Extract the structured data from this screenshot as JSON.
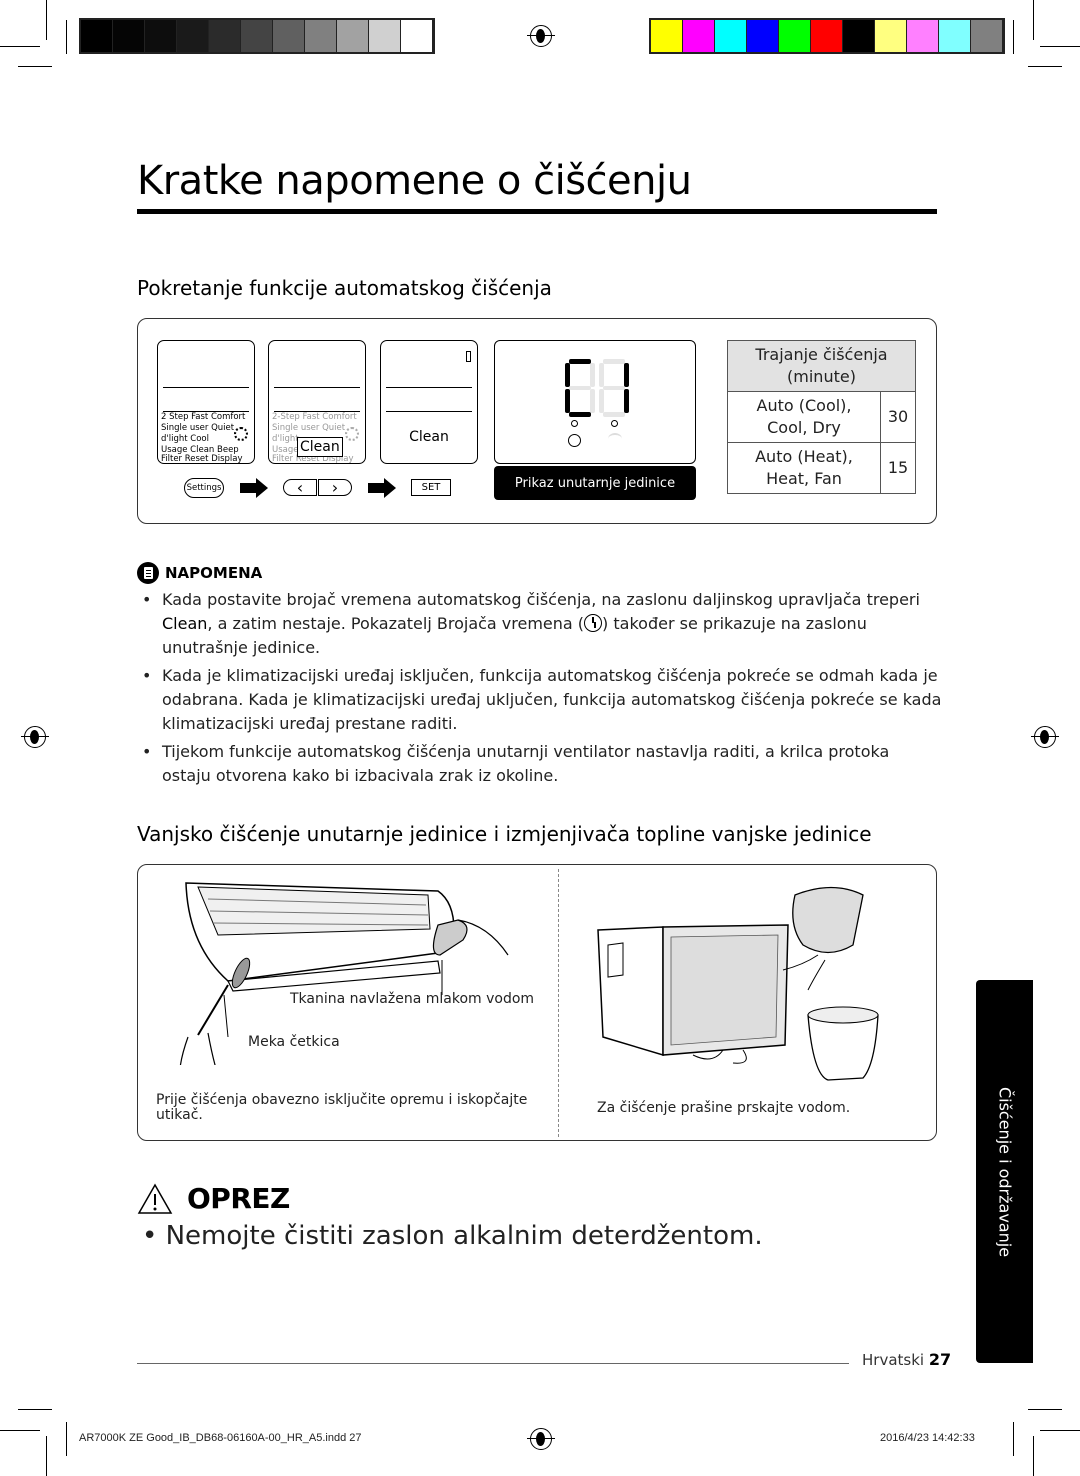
{
  "print_marks": {
    "gray_swatches": [
      "#000000",
      "#050505",
      "#0d0d0d",
      "#1a1a1a",
      "#2b2b2b",
      "#444444",
      "#606060",
      "#808080",
      "#a2a2a2",
      "#d0d0d0",
      "#ffffff"
    ],
    "color_swatches": [
      "#ffff00",
      "#ff00ff",
      "#00ffff",
      "#0000ff",
      "#00ff00",
      "#ff0000",
      "#000000",
      "#ffff80",
      "#ff80ff",
      "#80ffff",
      "#808080"
    ]
  },
  "page": {
    "title": "Kratke napomene o čišćenju",
    "section1_heading": "Pokretanje funkcije automatskog čišćenja",
    "section2_heading": "Vanjsko čišćenje unutarnje jedinice i izmjenjivača topline vanjske jedinice"
  },
  "remote_steps": {
    "menu_lines": [
      "2 Step  Fast  Comfort",
      "Single user  Quiet",
      "d'light Cool",
      "Usage   Clean   Beep",
      "Filter Reset    Display"
    ],
    "menu_lines_faded": [
      "2-Step  Fast  Comfort",
      "Single user  Quiet",
      "d'light",
      "Usage          Beep",
      "Filter Reset    Display"
    ],
    "highlight_label": "Clean",
    "result_label": "Clean",
    "settings_button": "Settings",
    "left_button": "‹",
    "right_button": "›",
    "set_button": "SET"
  },
  "indoor_display": {
    "digits": "C",
    "label": "Prikaz unutarnje jedinice",
    "timer_icon": "timer-icon",
    "wifi_icon": "wifi-icon"
  },
  "duration_table": {
    "header": [
      "Trajanje čišćenja",
      "(minute)"
    ],
    "rows": [
      {
        "modes": [
          "Auto (Cool),",
          "Cool, Dry"
        ],
        "minutes": "30"
      },
      {
        "modes": [
          "Auto (Heat),",
          "Heat, Fan"
        ],
        "minutes": "15"
      }
    ]
  },
  "note": {
    "heading": "NAPOMENA",
    "item1_a": "Kada postavite brojač vremena automatskog čišćenja, na zaslonu daljinskog upravljača treperi ",
    "item1_bold": "Clean",
    "item1_b": ", a zatim nestaje. Pokazatelj Brojača vremena (",
    "item1_c": ") također se prikazuje na zaslonu unutrašnje jedinice.",
    "item2": "Kada je klimatizacijski uređaj isključen, funkcija automatskog čišćenja pokreće se odmah kada je odabrana. Kada je klimatizacijski uređaj uključen, funkcija automatskog čišćenja pokreće se kada klimatizacijski uređaj prestane raditi.",
    "item3": "Tijekom funkcije automatskog čišćenja unutarnji ventilator nastavlja raditi, a krilca protoka ostaju otvorena kako bi izbacivala zrak iz okoline."
  },
  "illustration": {
    "cloth_label": "Tkanina navlažena mlakom vodom",
    "brush_label": "Meka četkica",
    "left_caption": "Prije čišćenja obavezno isključite opremu i iskopčajte utikač.",
    "right_caption": "Za čišćenje prašine prskajte vodom."
  },
  "caution": {
    "heading": "OPREZ",
    "item": "Nemojte čistiti zaslon alkalnim deterdžentom."
  },
  "side_tab": "Čišćenje i održavanje",
  "footer": {
    "language": "Hrvatski",
    "page_number": "27",
    "slug_file": "AR7000K ZE Good_IB_DB68-06160A-00_HR_A5.indd   27",
    "slug_date": "2016/4/23    14:42:33"
  }
}
